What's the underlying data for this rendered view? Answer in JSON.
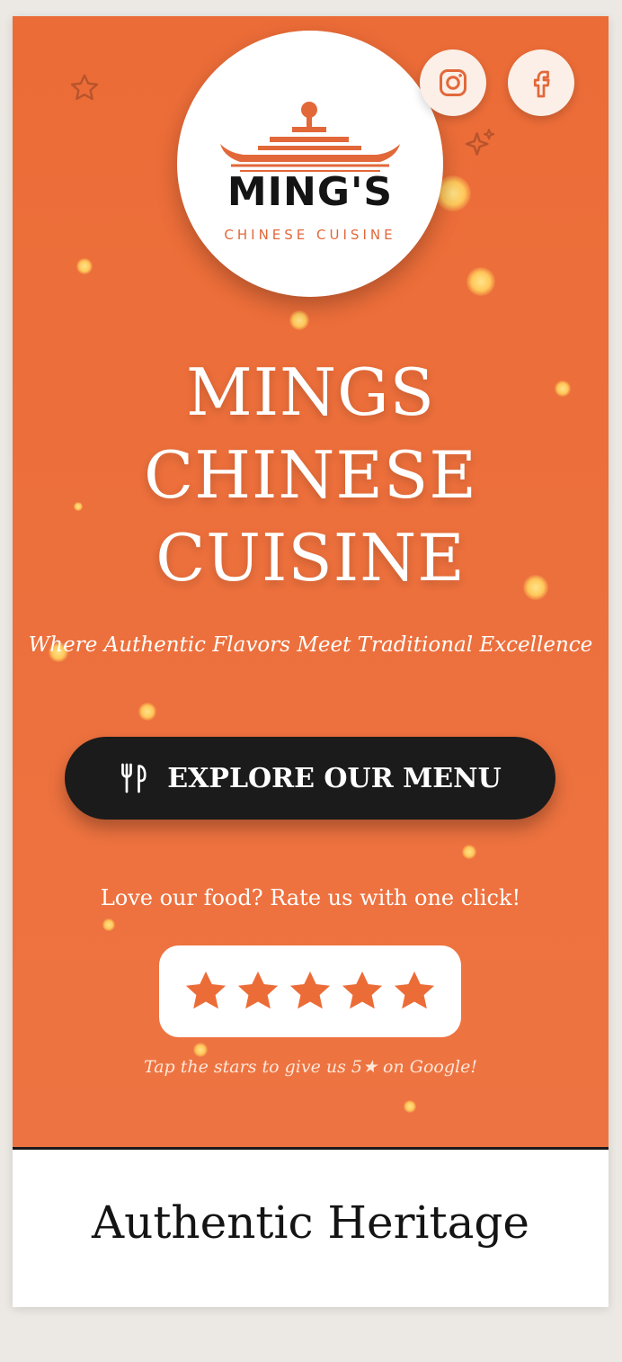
{
  "colors": {
    "accent": "#EC6C37",
    "dark": "#1B1B1B",
    "white": "#FFFFFF",
    "page_bg": "#ECE8E3"
  },
  "logo": {
    "wordmark": "MING'S",
    "subtitle": "CHINESE CUISINE",
    "icon": "boat-logo-icon"
  },
  "social": {
    "instagram_icon": "instagram-icon",
    "facebook_icon": "facebook-icon"
  },
  "hero": {
    "title_lines": [
      "MINGS",
      "CHINESE",
      "CUISINE"
    ],
    "tagline": "Where Authentic Flavors Meet Traditional Excellence",
    "menu_button": {
      "icon": "utensils-icon",
      "label": "EXPLORE OUR MENU"
    },
    "rating": {
      "prompt": "Love our food? Rate us with one click!",
      "stars": 5,
      "star_icon": "star-icon",
      "hint": "Tap the stars to give us 5★ on Google!"
    }
  },
  "heritage": {
    "title": "Authentic Heritage"
  }
}
